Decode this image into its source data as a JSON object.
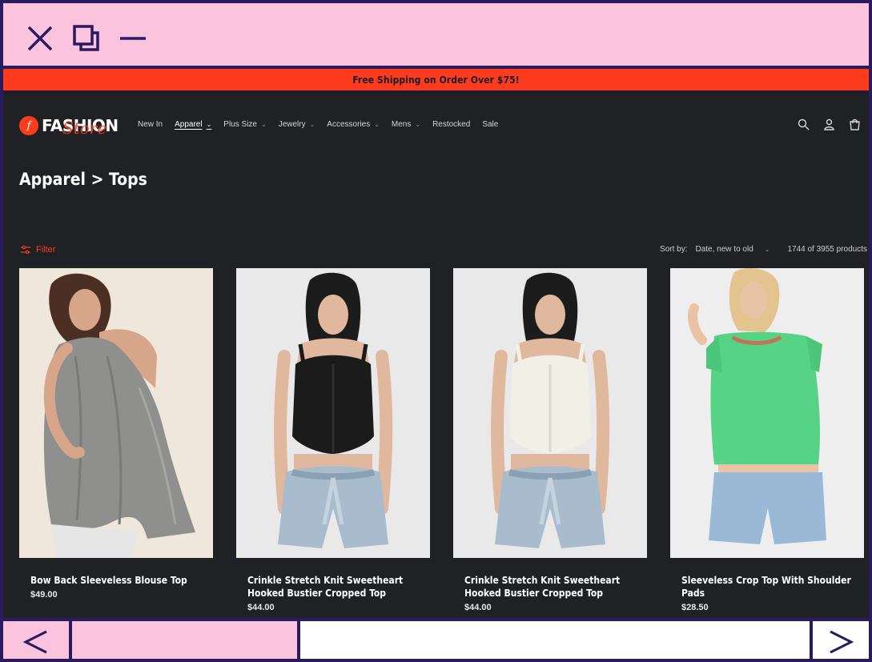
{
  "window": {
    "close_icon": "close-icon",
    "restore_icon": "restore-icon",
    "minimize_icon": "minimize-icon"
  },
  "announcement": "Free Shipping on Order Over $75!",
  "logo": {
    "text": "FASHION",
    "script": "Store",
    "mark": "f"
  },
  "nav": {
    "items": [
      {
        "label": "New In",
        "dropdown": false,
        "active": false
      },
      {
        "label": "Apparel",
        "dropdown": true,
        "active": true
      },
      {
        "label": "Plus Size",
        "dropdown": true,
        "active": false
      },
      {
        "label": "Jewelry",
        "dropdown": true,
        "active": false
      },
      {
        "label": "Accessories",
        "dropdown": true,
        "active": false
      },
      {
        "label": "Mens",
        "dropdown": true,
        "active": false
      },
      {
        "label": "Restocked",
        "dropdown": false,
        "active": false
      },
      {
        "label": "Sale",
        "dropdown": false,
        "active": false
      }
    ]
  },
  "header_icons": [
    "search-icon",
    "account-icon",
    "cart-icon"
  ],
  "page_title": "Apparel > Tops",
  "filter": {
    "label": "Filter"
  },
  "sort": {
    "label": "Sort by:",
    "value": "Date, new to old"
  },
  "product_count": "1744 of 3955 products",
  "products": [
    {
      "name": "Bow Back Sleeveless Blouse Top",
      "price": "$49.00"
    },
    {
      "name": "Crinkle Stretch Knit Sweetheart Hooked Bustier Cropped Top",
      "price": "$44.00"
    },
    {
      "name": "Crinkle Stretch Knit Sweetheart Hooked Bustier Cropped Top",
      "price": "$44.00"
    },
    {
      "name": "Sleeveless Crop Top With Shoulder Pads",
      "price": "$28.50"
    }
  ],
  "browser_nav": {
    "back_icon": "back-arrow-icon",
    "forward_icon": "forward-arrow-icon"
  },
  "colors": {
    "accent": "#ff3b1d",
    "chrome": "#fbc3de",
    "frame": "#2a1a5e",
    "page_bg": "#202124"
  }
}
